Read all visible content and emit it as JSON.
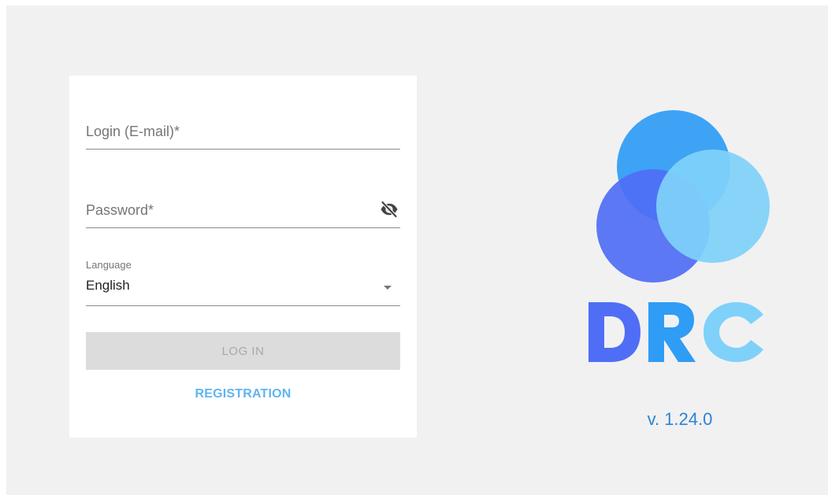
{
  "login_form": {
    "email_placeholder": "Login (E-mail)*",
    "password_placeholder": "Password*",
    "language_label": "Language",
    "language_value": "English",
    "login_button_label": "LOG IN",
    "registration_link_label": "REGISTRATION"
  },
  "logo": {
    "text": "DRC",
    "colors": {
      "circle_top": "#2f9cf5",
      "circle_left": "#4f6ef5",
      "circle_right": "#7fd1fa",
      "letter_d": "#4f6ef5",
      "letter_r": "#2f9cf5",
      "letter_c": "#7fd1fa"
    }
  },
  "version": "v. 1.24.0",
  "icons": {
    "password_toggle": "eye-off-icon",
    "language_dropdown": "chevron-down-icon"
  }
}
